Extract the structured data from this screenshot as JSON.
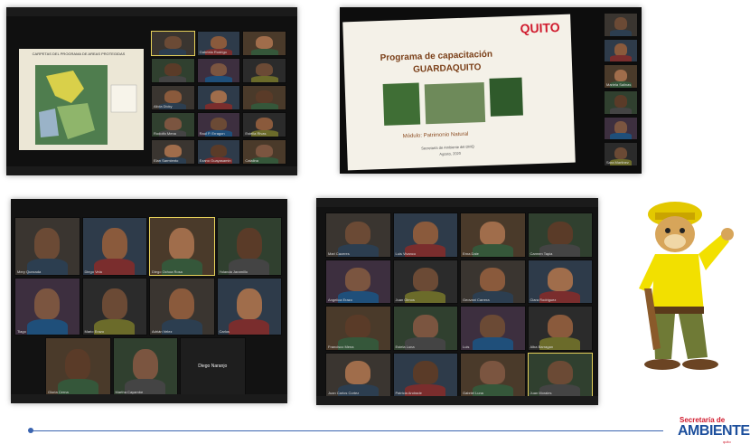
{
  "shot1": {
    "map_title": "CARPETAS DEL PROGRAMA DE AREAS PROTEGIDAS",
    "names": [
      "",
      "Gabriela Rodrigo",
      "",
      "",
      "",
      "",
      "Alicia Dicky",
      "",
      "",
      "Rodolfo Mena",
      "Raul P. Erragon",
      "Estella Rivas",
      "Elan Sarmiento",
      "Ezano Guayasamin",
      "Catalina"
    ]
  },
  "slide": {
    "logo": "QUITO",
    "title": "Programa de capacitación",
    "subtitle": "GUARDAQUITO",
    "module": "Módulo: Patrimonio Natural",
    "org": "Secretaría de Ambiente del DMQ",
    "date": "Agosto, 2020",
    "side_names": [
      "",
      "",
      "Mariela Salinas",
      "",
      "",
      "Sara Martinez"
    ]
  },
  "shot3": {
    "names": [
      "Mery Quezada",
      "Diego Vela",
      "Diego Ochoa Rosa",
      "Yolanda Jaramillo",
      "Tiago",
      "Mario Erazo",
      "Adrián Velez",
      "Carlos",
      "Gloria Cerna",
      "Martha Cayambe"
    ],
    "name_only": "Diego Naranjo"
  },
  "shot4": {
    "names": [
      "Mari Caceres",
      "Luis Vivanco",
      "Erna Dale",
      "Carmen Tapia",
      "Angelica Erazo",
      "Juan Olmos",
      "Geovani Carrera",
      "Clara Rodriguez",
      "Francisco Mena",
      "Estela Luna",
      "Luis",
      "Alba Barragan",
      "Juan Carlos Cortez",
      "Patricia Andrade",
      "Gabriel Luna",
      "Juan Morales"
    ]
  },
  "logo": {
    "top": "Secretaría de",
    "main": "AMBIENTE",
    "sub": "quito"
  },
  "colors": {
    "highlight": "#e7d25a",
    "mascot_shirt": "#f2e000",
    "mascot_pants": "#6f7a36",
    "brand_blue": "#1d4f9c",
    "brand_red": "#d0192c"
  }
}
